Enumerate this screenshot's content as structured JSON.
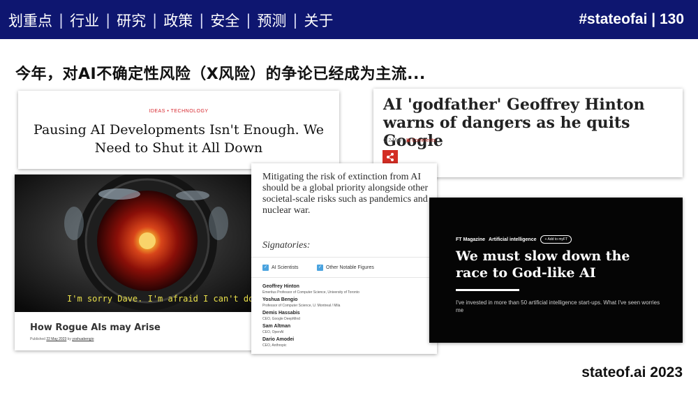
{
  "nav": {
    "items": [
      "划重点",
      "行业",
      "研究",
      "政策",
      "安全",
      "预测",
      "关于"
    ],
    "separator": "|",
    "tag": "#stateofai | 130"
  },
  "headline": "今年，对AI不确定性风险（X风险）的争论已经成为主流...",
  "card_time": {
    "kicker": "IDEAS • TECHNOLOGY",
    "title": "Pausing AI Developments Isn't Enough. We Need to Shut it All Down"
  },
  "card_hinton": {
    "title": "AI 'godfather' Geoffrey Hinton warns of dangers as he quits Google",
    "date": "2 May",
    "comments": "Comments",
    "share_icon": "share-icon"
  },
  "card_hal": {
    "caption": "I'm sorry Dave. I'm afraid I can't do that",
    "title": "How Rogue AIs may Arise",
    "published_label": "Published",
    "date": "22 May 2023",
    "by_label": "by",
    "author": "yoshuabengio"
  },
  "card_statement": {
    "statement": "Mitigating the risk of extinction from AI should be a global priority alongside other societal-scale risks such as pandemics and nuclear war.",
    "signatories_label": "Signatories:",
    "tabs": [
      "AI Scientists",
      "Other Notable Figures"
    ],
    "people": [
      {
        "name": "Geoffrey Hinton",
        "role": "Emeritus Professor of Computer Science, University of Toronto"
      },
      {
        "name": "Yoshua Bengio",
        "role": "Professor of Computer Science, U. Montreal / Mila"
      },
      {
        "name": "Demis Hassabis",
        "role": "CEO, Google DeepMind"
      },
      {
        "name": "Sam Altman",
        "role": "CEO, OpenAI"
      },
      {
        "name": "Dario Amodei",
        "role": "CEO, Anthropic"
      }
    ]
  },
  "card_ft": {
    "kicker1": "FT Magazine",
    "kicker2": "Artificial intelligence",
    "add_button": "+ Add to myFT",
    "title": "We must slow down the race to God-like AI",
    "subtitle": "I've invested in more than 50 artificial intelligence start-ups. What I've seen worries me"
  },
  "footer": "stateof.ai 2023",
  "colors": {
    "nav_bg": "#0e1670",
    "accent_red": "#d32d24",
    "check_blue": "#4aa3df"
  }
}
